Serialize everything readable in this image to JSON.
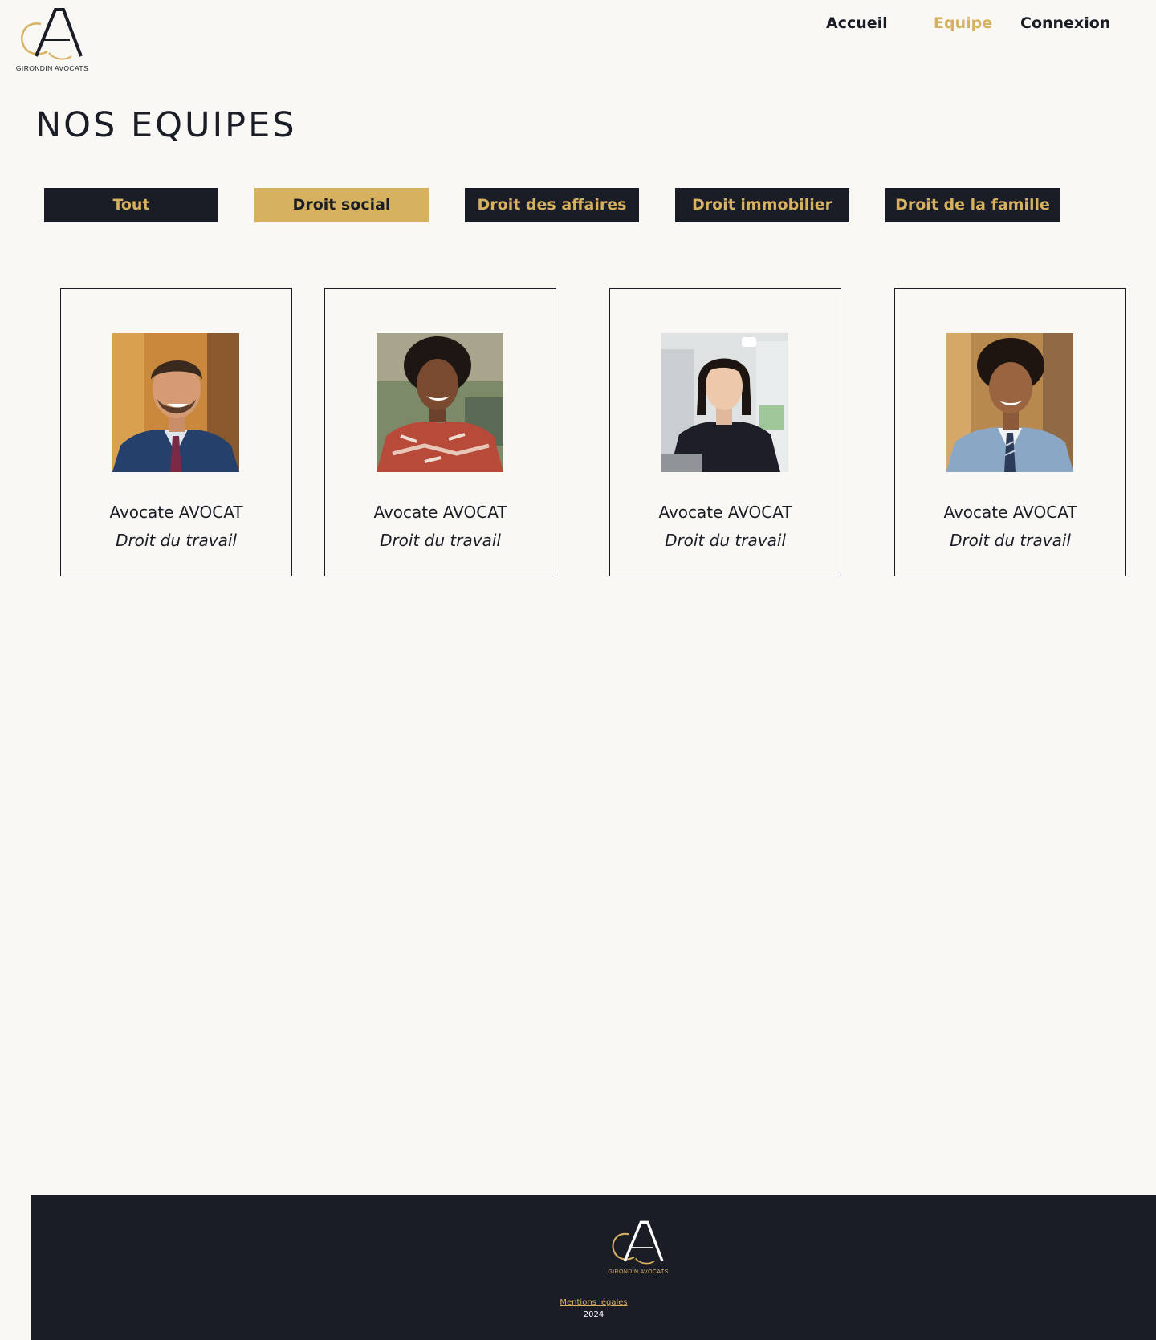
{
  "brand": {
    "name": "GIRONDIN AVOCATS",
    "logo_icon": "ga-monogram-logo",
    "colors": {
      "gold": "#d6b15f",
      "dark": "#1b1d26",
      "background": "#f9f8f4"
    }
  },
  "nav": {
    "items": [
      {
        "label": "Accueil",
        "active": false
      },
      {
        "label": "Equipe",
        "active": true
      },
      {
        "label": "Connexion",
        "active": false
      }
    ]
  },
  "page_title": "NOS EQUIPES",
  "filters": [
    {
      "label": "Tout",
      "active": false
    },
    {
      "label": "Droit social",
      "active": true
    },
    {
      "label": "Droit des affaires",
      "active": false
    },
    {
      "label": "Droit immobilier",
      "active": false
    },
    {
      "label": "Droit de la famille",
      "active": false
    }
  ],
  "team": [
    {
      "name": "Avocate AVOCAT",
      "specialty": "Droit du travail",
      "photo": "portrait-man-blue-suit"
    },
    {
      "name": "Avocate AVOCAT",
      "specialty": "Droit du travail",
      "photo": "portrait-woman-red-blouse"
    },
    {
      "name": "Avocate AVOCAT",
      "specialty": "Droit du travail",
      "photo": "portrait-woman-black-top"
    },
    {
      "name": "Avocate AVOCAT",
      "specialty": "Droit du travail",
      "photo": "portrait-man-light-blue-suit"
    }
  ],
  "footer": {
    "brand_name": "GIRONDIN AVOCATS",
    "legal_link": "Mentions légales",
    "year": "2024"
  }
}
